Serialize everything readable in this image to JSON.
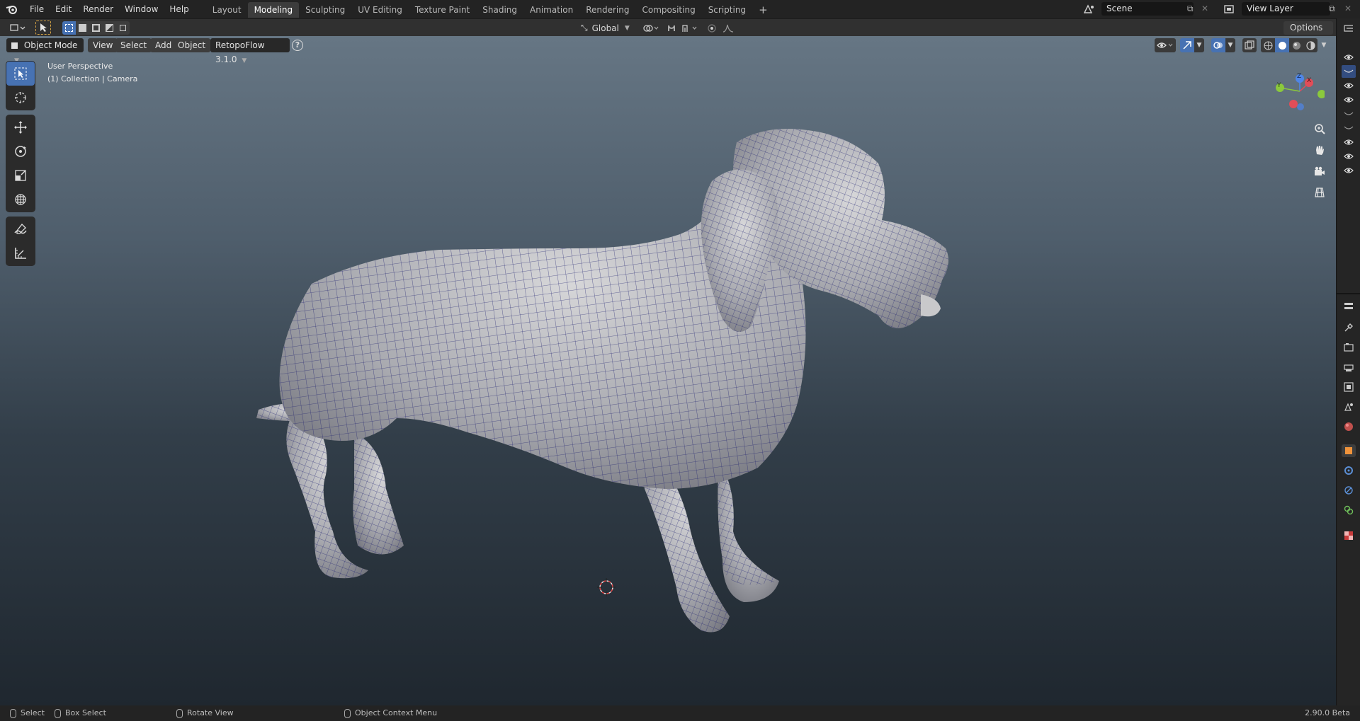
{
  "menu": [
    "File",
    "Edit",
    "Render",
    "Window",
    "Help"
  ],
  "workspaces": [
    "Layout",
    "Modeling",
    "Sculpting",
    "UV Editing",
    "Texture Paint",
    "Shading",
    "Animation",
    "Rendering",
    "Compositing",
    "Scripting"
  ],
  "add_workspace": "+",
  "scene": {
    "name": "Scene"
  },
  "view_layer": {
    "name": "View Layer"
  },
  "transform": {
    "orientation": "Global"
  },
  "options_label": "Options",
  "viewport_header": {
    "mode": "Object Mode",
    "view": "View",
    "select": "Select",
    "add": "Add",
    "object": "Object",
    "addon": "RetopoFlow 3.1.0",
    "help": "?"
  },
  "viewport_info": {
    "perspective": "User Perspective",
    "collection": "(1) Collection | Camera"
  },
  "gizmo": {
    "x": "X",
    "y": "Y",
    "z": "Z"
  },
  "status": {
    "select": "Select",
    "box_select": "Box Select",
    "rotate": "Rotate View",
    "context": "Object Context Menu",
    "version": "2.90.0 Beta"
  },
  "colors": {
    "accent": "#4772b3",
    "axis_x": "#e24d58",
    "axis_y": "#8bc93c",
    "axis_z": "#4f86e8",
    "mesh_wire": "#1d1f70"
  }
}
